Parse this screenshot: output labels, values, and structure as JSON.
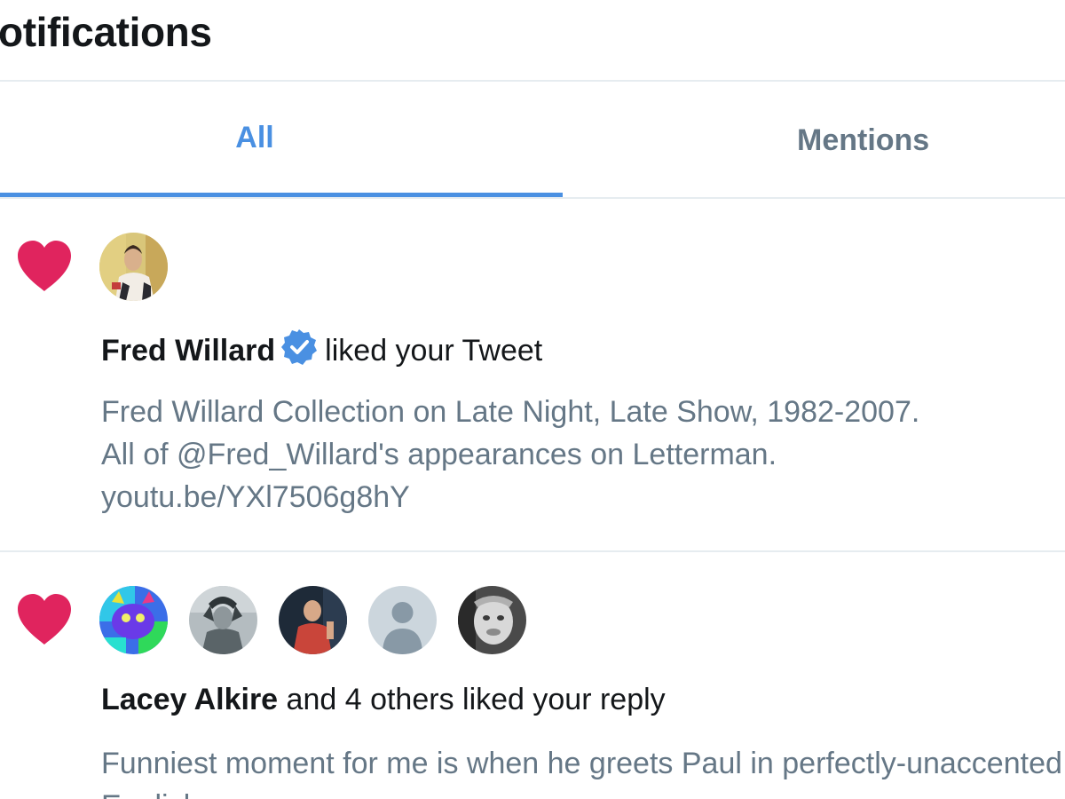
{
  "header": {
    "title": "otifications"
  },
  "tabs": [
    {
      "label": "All",
      "selected": true
    },
    {
      "label": "Mentions",
      "selected": false
    }
  ],
  "colors": {
    "accent": "#4a90e2",
    "heart": "#e0245e",
    "muted_text": "#657786",
    "primary_text": "#14171a",
    "verified_badge": "#4a90e2"
  },
  "notifications": [
    {
      "icon": "heart-icon",
      "avatars": [
        "avatar-fred-willard"
      ],
      "user_name": "Fred Willard",
      "verified": true,
      "action": "liked your Tweet",
      "tweet_lines": [
        "Fred Willard Collection on Late Night, Late Show, 1982-2007.",
        "All of @Fred_Willard's appearances on Letterman.",
        "youtu.be/YXl7506g8hY"
      ]
    },
    {
      "icon": "heart-icon",
      "avatars": [
        "avatar-colorful-cat",
        "avatar-gray-person",
        "avatar-red-shirt",
        "avatar-default",
        "avatar-gray-face"
      ],
      "user_name": "Lacey Alkire",
      "verified": false,
      "action": "and 4 others liked your reply",
      "tweet_lines": [
        "Funniest moment for me is when he greets Paul in perfectly-unaccented",
        "English"
      ]
    }
  ]
}
